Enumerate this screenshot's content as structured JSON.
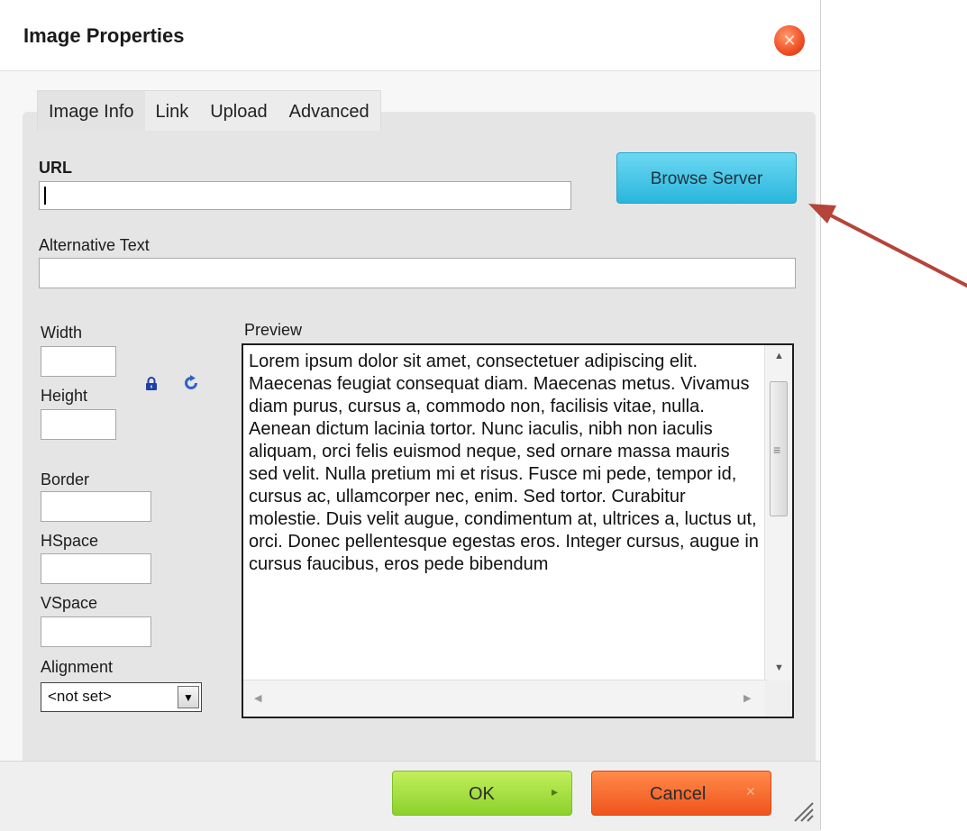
{
  "dialog": {
    "title": "Image Properties"
  },
  "tabs": [
    {
      "label": "Image Info",
      "active": true
    },
    {
      "label": "Link",
      "active": false
    },
    {
      "label": "Upload",
      "active": false
    },
    {
      "label": "Advanced",
      "active": false
    }
  ],
  "fields": {
    "url_label": "URL",
    "url_value": "",
    "browse_label": "Browse Server",
    "alt_label": "Alternative Text",
    "alt_value": "",
    "width_label": "Width",
    "height_label": "Height",
    "border_label": "Border",
    "hspace_label": "HSpace",
    "vspace_label": "VSpace",
    "alignment_label": "Alignment",
    "alignment_value": "<not set>"
  },
  "preview": {
    "label": "Preview",
    "text": "Lorem ipsum dolor sit amet, consectetuer adipiscing elit. Maecenas feugiat consequat diam. Maecenas metus. Vivamus diam purus, cursus a, commodo non, facilisis vitae, nulla. Aenean dictum lacinia tortor. Nunc iaculis, nibh non iaculis aliquam, orci felis euismod neque, sed ornare massa mauris sed velit. Nulla pretium mi et risus. Fusce mi pede, tempor id, cursus ac, ullamcorper nec, enim. Sed tortor. Curabitur molestie. Duis velit augue, condimentum at, ultrices a, luctus ut, orci. Donec pellentesque egestas eros. Integer cursus, augue in cursus faucibus, eros pede bibendum"
  },
  "footer": {
    "ok_label": "OK",
    "cancel_label": "Cancel"
  },
  "icons": {
    "close": "close-icon",
    "lock": "lock-icon",
    "reset": "reset-size-icon"
  },
  "colors": {
    "browse_button": "#2ab6dd",
    "ok_button": "#8cd12c",
    "cancel_button": "#f0541c",
    "close_button": "#f2542a",
    "annotation_arrow": "#b5443a"
  }
}
